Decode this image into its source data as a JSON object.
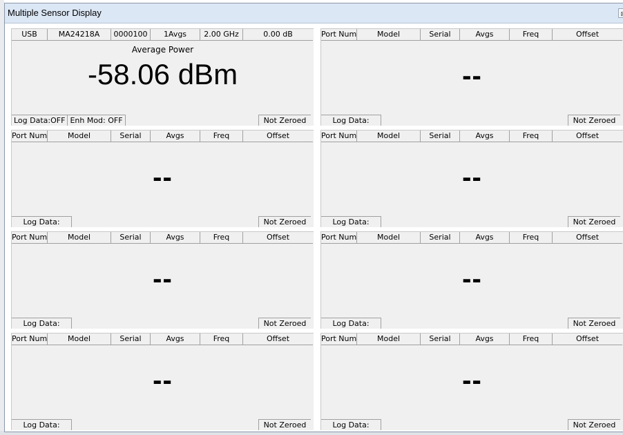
{
  "window": {
    "title": "Multiple Sensor Display",
    "close_glyph": "⊠"
  },
  "headers": [
    "Port Num",
    "Model",
    "Serial",
    "Avgs",
    "Freq",
    "Offset"
  ],
  "placeholder": "--",
  "footer": {
    "log_label": "Log Data:",
    "zero_status": "Not Zeroed"
  },
  "active_panel": {
    "port": "USB",
    "model": "MA24218A",
    "serial": "0000100",
    "avgs": "1Avgs",
    "freq": "2.00 GHz",
    "offset": "0.00 dB",
    "measurement_label": "Average Power",
    "reading": "-58.06 dBm",
    "log_data": "Log Data:OFF",
    "enh_mod": "Enh Mod: OFF",
    "zero_status": "Not Zeroed"
  }
}
